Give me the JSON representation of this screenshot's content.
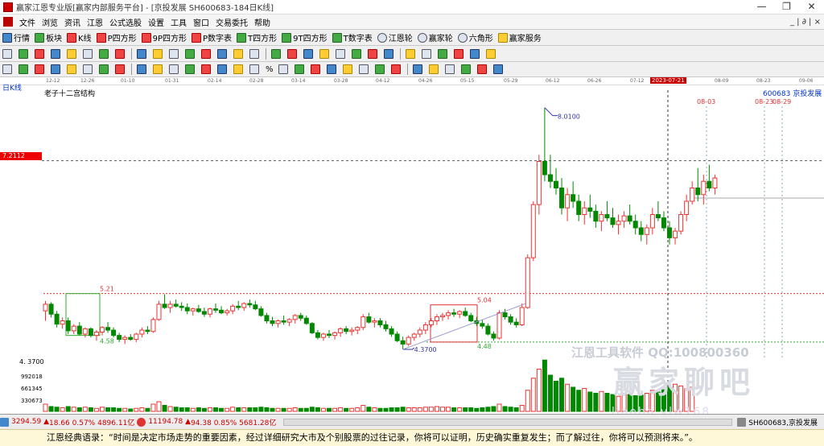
{
  "titlebar": {
    "text": "赢家江恩专业版[赢家内部服务平台] - [京投发展  SH600683-184日K线]",
    "min": "—",
    "restore": "❐",
    "close": "✕"
  },
  "menu": {
    "items": [
      "文件",
      "浏览",
      "资讯",
      "江恩",
      "公式选股",
      "设置",
      "工具",
      "窗口",
      "交易委托",
      "帮助"
    ],
    "right": "_ | ∂ | ×"
  },
  "toolbar1": [
    "行情",
    "板块",
    "K线",
    "P四方形",
    "9P四方形",
    "P数字表",
    "T四方形",
    "9T四方形",
    "T数字表",
    "江恩轮",
    "赢家轮",
    "六角形",
    "赢家服务"
  ],
  "toolbar3": {
    "percent": "%"
  },
  "datebar": {
    "dates": [
      "12-12",
      "12-26",
      "01-10",
      "01-31",
      "02-14",
      "02-28",
      "03-14",
      "03-28",
      "04-12",
      "04-26",
      "05-15",
      "05-29",
      "06-12",
      "06-26",
      "07-12",
      "08-09",
      "08-23",
      "09-06"
    ],
    "current": "2023-07-21"
  },
  "chart": {
    "period_label": "日K线",
    "structure_label": "老子十二宫结构",
    "code_label": "600683  京投发展",
    "current_price": "7.2112",
    "high_label": "8.0100",
    "low_label": "4.3700",
    "axis_low": "4. 3700",
    "box1_high": "5.21",
    "box1_low": "4.58",
    "box2_high": "5.04",
    "box2_low": "4.48",
    "future_dates": [
      "08-03",
      "08-23",
      "08-29"
    ],
    "volume_ticks": [
      "992018",
      "661345",
      "330673"
    ],
    "watermark1": "江恩工具软件  QQ:100800360",
    "watermark2": "赢家聊吧",
    "watermark3": "liaoba.ylw168"
  },
  "chart_data": {
    "type": "candlestick",
    "title": "老子十二宫结构",
    "ylim": [
      4.2,
      8.2
    ],
    "price_lines": [
      7.2112,
      5.21,
      4.48
    ],
    "candles": [
      [
        4.95,
        5.1,
        4.8,
        5.05
      ],
      [
        5.05,
        5.08,
        4.85,
        4.9
      ],
      [
        4.9,
        4.95,
        4.7,
        4.75
      ],
      [
        4.75,
        4.85,
        4.68,
        4.8
      ],
      [
        4.8,
        4.85,
        4.6,
        4.65
      ],
      [
        4.65,
        4.75,
        4.6,
        4.72
      ],
      [
        4.72,
        4.78,
        4.58,
        4.6
      ],
      [
        4.6,
        4.7,
        4.55,
        4.68
      ],
      [
        4.68,
        4.7,
        4.55,
        4.58
      ],
      [
        4.58,
        4.66,
        4.5,
        4.63
      ],
      [
        4.63,
        4.72,
        4.58,
        4.7
      ],
      [
        4.7,
        4.78,
        4.62,
        4.66
      ],
      [
        4.66,
        4.7,
        4.55,
        4.58
      ],
      [
        4.58,
        4.62,
        4.48,
        4.52
      ],
      [
        4.52,
        4.58,
        4.45,
        4.55
      ],
      [
        4.55,
        4.6,
        4.5,
        4.52
      ],
      [
        4.52,
        4.62,
        4.48,
        4.6
      ],
      [
        4.6,
        4.7,
        4.55,
        4.66
      ],
      [
        4.66,
        4.72,
        4.6,
        4.64
      ],
      [
        4.64,
        4.85,
        4.62,
        4.82
      ],
      [
        4.82,
        5.1,
        4.8,
        5.05
      ],
      [
        5.05,
        5.2,
        4.98,
        5.0
      ],
      [
        5.0,
        5.1,
        4.92,
        5.05
      ],
      [
        5.05,
        5.12,
        5.0,
        5.02
      ],
      [
        5.02,
        5.08,
        4.95,
        5.0
      ],
      [
        5.0,
        5.06,
        4.9,
        4.95
      ],
      [
        4.95,
        5.0,
        4.88,
        4.98
      ],
      [
        4.98,
        5.04,
        4.92,
        4.94
      ],
      [
        4.94,
        5.0,
        4.86,
        4.9
      ],
      [
        4.9,
        5.0,
        4.85,
        4.98
      ],
      [
        4.98,
        5.06,
        4.92,
        4.96
      ],
      [
        4.96,
        5.02,
        4.9,
        4.92
      ],
      [
        4.92,
        4.98,
        4.88,
        4.95
      ],
      [
        4.95,
        5.05,
        4.9,
        5.02
      ],
      [
        5.02,
        5.1,
        4.96,
        5.0
      ],
      [
        5.0,
        5.08,
        4.95,
        5.06
      ],
      [
        5.06,
        5.12,
        5.0,
        5.04
      ],
      [
        5.04,
        5.1,
        4.96,
        4.98
      ],
      [
        4.98,
        5.02,
        4.86,
        4.88
      ],
      [
        4.88,
        4.92,
        4.76,
        4.8
      ],
      [
        4.8,
        4.86,
        4.72,
        4.76
      ],
      [
        4.76,
        4.82,
        4.7,
        4.8
      ],
      [
        4.8,
        4.88,
        4.74,
        4.78
      ],
      [
        4.78,
        4.84,
        4.72,
        4.82
      ],
      [
        4.82,
        4.9,
        4.76,
        4.88
      ],
      [
        4.88,
        4.92,
        4.8,
        4.84
      ],
      [
        4.84,
        4.88,
        4.74,
        4.76
      ],
      [
        4.76,
        4.78,
        4.6,
        4.62
      ],
      [
        4.62,
        4.66,
        4.52,
        4.55
      ],
      [
        4.55,
        4.62,
        4.5,
        4.6
      ],
      [
        4.6,
        4.66,
        4.54,
        4.58
      ],
      [
        4.58,
        4.64,
        4.52,
        4.62
      ],
      [
        4.62,
        4.7,
        4.56,
        4.68
      ],
      [
        4.68,
        4.72,
        4.6,
        4.64
      ],
      [
        4.64,
        4.7,
        4.58,
        4.66
      ],
      [
        4.66,
        4.72,
        4.6,
        4.7
      ],
      [
        4.7,
        4.9,
        4.66,
        4.86
      ],
      [
        4.86,
        4.92,
        4.76,
        4.78
      ],
      [
        4.78,
        4.84,
        4.7,
        4.8
      ],
      [
        4.8,
        4.84,
        4.7,
        4.74
      ],
      [
        4.74,
        4.8,
        4.64,
        4.68
      ],
      [
        4.68,
        4.72,
        4.56,
        4.6
      ],
      [
        4.6,
        4.64,
        4.48,
        4.5
      ],
      [
        4.5,
        4.56,
        4.37,
        4.45
      ],
      [
        4.45,
        4.58,
        4.42,
        4.55
      ],
      [
        4.55,
        4.62,
        4.5,
        4.6
      ],
      [
        4.6,
        4.7,
        4.55,
        4.66
      ],
      [
        4.66,
        4.78,
        4.6,
        4.74
      ],
      [
        4.74,
        4.84,
        4.7,
        4.8
      ],
      [
        4.8,
        4.9,
        4.74,
        4.86
      ],
      [
        4.86,
        4.92,
        4.8,
        4.88
      ],
      [
        4.88,
        4.96,
        4.82,
        4.92
      ],
      [
        4.92,
        4.98,
        4.86,
        4.9
      ],
      [
        4.9,
        4.96,
        4.84,
        4.94
      ],
      [
        4.94,
        5.0,
        4.86,
        4.88
      ],
      [
        4.88,
        4.92,
        4.78,
        4.8
      ],
      [
        4.8,
        4.86,
        4.72,
        4.76
      ],
      [
        4.76,
        4.82,
        4.68,
        4.72
      ],
      [
        4.72,
        4.76,
        4.58,
        4.6
      ],
      [
        4.6,
        4.64,
        4.5,
        4.54
      ],
      [
        4.54,
        4.96,
        4.52,
        4.92
      ],
      [
        4.92,
        4.98,
        4.82,
        4.86
      ],
      [
        4.86,
        4.9,
        4.74,
        4.78
      ],
      [
        4.78,
        4.84,
        4.7,
        4.74
      ],
      [
        4.74,
        5.06,
        4.72,
        5.0
      ],
      [
        5.0,
        5.8,
        4.98,
        5.75
      ],
      [
        5.75,
        6.6,
        5.7,
        6.55
      ],
      [
        6.55,
        7.3,
        6.4,
        7.2
      ],
      [
        7.2,
        8.01,
        6.9,
        7.0
      ],
      [
        7.0,
        7.3,
        6.8,
        6.9
      ],
      [
        6.9,
        7.1,
        6.7,
        6.8
      ],
      [
        6.8,
        6.95,
        6.4,
        6.5
      ],
      [
        6.5,
        6.8,
        6.3,
        6.7
      ],
      [
        6.7,
        6.9,
        6.5,
        6.6
      ],
      [
        6.6,
        6.7,
        6.3,
        6.4
      ],
      [
        6.4,
        6.6,
        6.25,
        6.5
      ],
      [
        6.5,
        6.7,
        6.35,
        6.45
      ],
      [
        6.45,
        6.55,
        6.2,
        6.3
      ],
      [
        6.3,
        6.45,
        6.15,
        6.4
      ],
      [
        6.4,
        6.6,
        6.3,
        6.35
      ],
      [
        6.35,
        6.5,
        6.2,
        6.25
      ],
      [
        6.25,
        6.4,
        6.1,
        6.3
      ],
      [
        6.3,
        6.45,
        6.2,
        6.38
      ],
      [
        6.38,
        6.55,
        6.25,
        6.3
      ],
      [
        6.3,
        6.4,
        6.1,
        6.2
      ],
      [
        6.2,
        6.3,
        6.0,
        6.1
      ],
      [
        6.1,
        6.25,
        5.95,
        6.2
      ],
      [
        6.2,
        6.5,
        6.1,
        6.4
      ],
      [
        6.4,
        6.6,
        6.3,
        6.35
      ],
      [
        6.35,
        6.45,
        6.15,
        6.2
      ],
      [
        6.2,
        6.3,
        5.95,
        6.05
      ],
      [
        6.05,
        6.2,
        5.95,
        6.15
      ],
      [
        6.15,
        6.45,
        6.1,
        6.4
      ],
      [
        6.4,
        6.7,
        6.3,
        6.6
      ],
      [
        6.6,
        6.9,
        6.55,
        6.8
      ],
      [
        6.8,
        7.1,
        6.6,
        6.7
      ],
      [
        6.7,
        7.0,
        6.55,
        6.9
      ],
      [
        6.9,
        7.15,
        6.75,
        6.8
      ],
      [
        6.8,
        7.0,
        6.7,
        6.95
      ]
    ],
    "volumes": [
      0.12,
      0.08,
      0.07,
      0.06,
      0.08,
      0.07,
      0.06,
      0.07,
      0.06,
      0.05,
      0.07,
      0.06,
      0.06,
      0.05,
      0.05,
      0.04,
      0.05,
      0.06,
      0.05,
      0.12,
      0.16,
      0.1,
      0.08,
      0.07,
      0.06,
      0.06,
      0.05,
      0.06,
      0.05,
      0.06,
      0.06,
      0.05,
      0.05,
      0.07,
      0.06,
      0.06,
      0.06,
      0.06,
      0.07,
      0.06,
      0.05,
      0.05,
      0.05,
      0.05,
      0.06,
      0.05,
      0.05,
      0.07,
      0.06,
      0.05,
      0.05,
      0.05,
      0.06,
      0.05,
      0.05,
      0.06,
      0.1,
      0.07,
      0.06,
      0.05,
      0.05,
      0.06,
      0.06,
      0.07,
      0.06,
      0.06,
      0.06,
      0.07,
      0.07,
      0.08,
      0.07,
      0.07,
      0.06,
      0.06,
      0.06,
      0.06,
      0.05,
      0.06,
      0.07,
      0.08,
      0.12,
      0.08,
      0.07,
      0.06,
      0.1,
      0.35,
      0.55,
      0.7,
      0.85,
      0.6,
      0.5,
      0.55,
      0.45,
      0.4,
      0.35,
      0.38,
      0.32,
      0.3,
      0.33,
      0.3,
      0.28,
      0.25,
      0.3,
      0.28,
      0.26,
      0.27,
      0.3,
      0.35,
      0.32,
      0.36,
      0.4,
      0.45,
      0.42,
      0.38,
      0.4
    ]
  },
  "status": {
    "sh": "3294.59",
    "sh_chg": "18.66 0.57% 4896.11亿",
    "sz": "11194.78",
    "sz_chg": "94.38 0.85% 5681.28亿",
    "code": "SH600683,京投发展"
  },
  "quote": "江恩经典语录：“时间是决定市场走势的重要因素，经过详细研究大市及个别股票的过往记录，你将可以证明，历史确实重复发生；而了解过往，你将可以预测将来。”。"
}
